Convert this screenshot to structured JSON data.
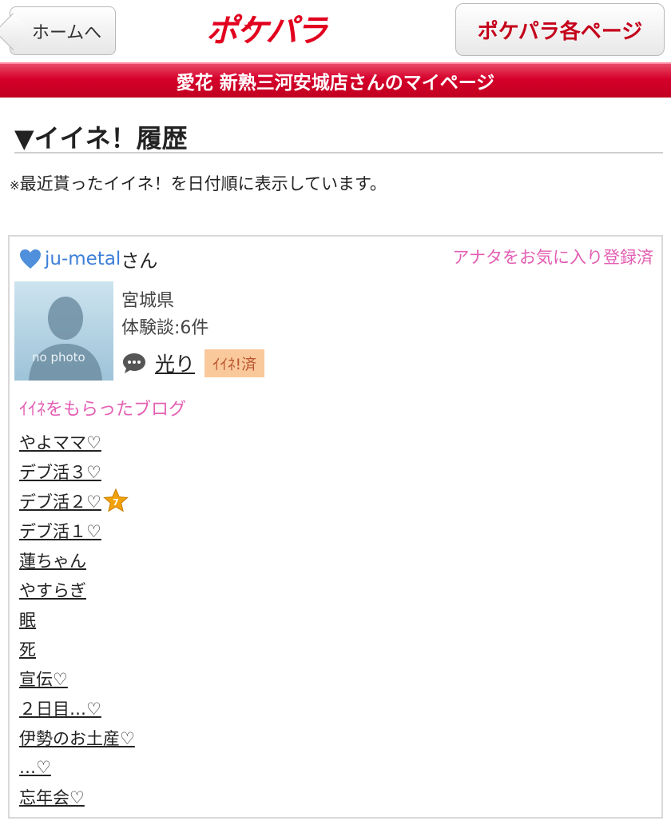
{
  "header": {
    "home_label": "ホームへ",
    "logo_text": "ポケパラ",
    "pages_label": "ポケパラ各ページ"
  },
  "banner": {
    "title": "愛花 新熟三河安城店さんのマイページ"
  },
  "section": {
    "title": "▼イイネ！履歴",
    "note_mark": "※",
    "note_text": "最近貰ったイイネ！を日付順に表示しています。"
  },
  "card": {
    "user_name": "ju-metal",
    "user_suffix": "さん",
    "fav_status": "アナタをお気に入り登録済",
    "avatar_label": "no photo",
    "prefecture": "宮城県",
    "reviews": "体験談:6件",
    "comment_link": "光り",
    "like_badge": "ｲｲﾈ!済",
    "blogs_heading": "ｲｲﾈをもらったブログ",
    "blogs": [
      "やよママ♡",
      "デブ活３♡",
      "デブ活２♡",
      "デブ活１♡",
      "蓮ちゃん",
      "やすらぎ",
      "眠",
      "死",
      "宣伝♡",
      "２日目…♡",
      "伊勢のお土産♡",
      "…♡",
      "忘年会♡"
    ],
    "star_badge_number": "7"
  },
  "colors": {
    "brand_red": "#e2001f",
    "banner_red": "#d5002a",
    "pink": "#e35fb3",
    "user_blue": "#3d7fd9",
    "badge_bg": "#f9c89b"
  },
  "icons": {
    "heart": "heart-icon",
    "comment": "speech-bubble-icon",
    "star": "star-badge-icon"
  }
}
